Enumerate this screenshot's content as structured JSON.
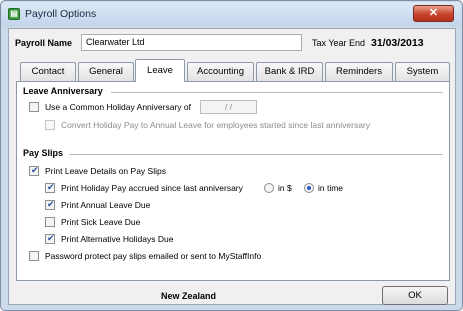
{
  "window": {
    "title": "Payroll Options",
    "close_label": "✕"
  },
  "header": {
    "payroll_name_label": "Payroll Name",
    "payroll_name_value": "Clearwater Ltd",
    "tax_year_end_label": "Tax Year End",
    "tax_year_end_value": "31/03/2013"
  },
  "tabs": [
    {
      "label": "Contact",
      "active": false
    },
    {
      "label": "General",
      "active": false
    },
    {
      "label": "Leave",
      "active": true
    },
    {
      "label": "Accounting",
      "active": false
    },
    {
      "label": "Bank & IRD",
      "active": false
    },
    {
      "label": "Reminders",
      "active": false
    },
    {
      "label": "System",
      "active": false
    }
  ],
  "leave_anniversary": {
    "heading": "Leave Anniversary",
    "common_holiday": {
      "label": "Use a Common Holiday Anniversary of",
      "checked": false
    },
    "date_value": "/   /",
    "convert_holiday": {
      "label": "Convert Holiday Pay to Annual Leave for employees started since last anniversary",
      "checked": false,
      "disabled": true
    }
  },
  "pay_slips": {
    "heading": "Pay Slips",
    "print_leave_details": {
      "label": "Print Leave Details on Pay Slips",
      "checked": true
    },
    "print_holiday_pay": {
      "label": "Print Holiday Pay accrued since last anniversary",
      "checked": true
    },
    "radio_in_dollars": {
      "label": "in $",
      "selected": false
    },
    "radio_in_time": {
      "label": "in time",
      "selected": true
    },
    "print_annual_leave": {
      "label": "Print Annual Leave Due",
      "checked": true
    },
    "print_sick_leave": {
      "label": "Print Sick Leave Due",
      "checked": false
    },
    "print_alternative": {
      "label": "Print Alternative Holidays Due",
      "checked": true
    },
    "password_protect": {
      "label": "Password protect pay slips emailed or sent to MyStaffInfo",
      "checked": false
    }
  },
  "footer": {
    "country": "New Zealand",
    "ok_label": "OK"
  }
}
